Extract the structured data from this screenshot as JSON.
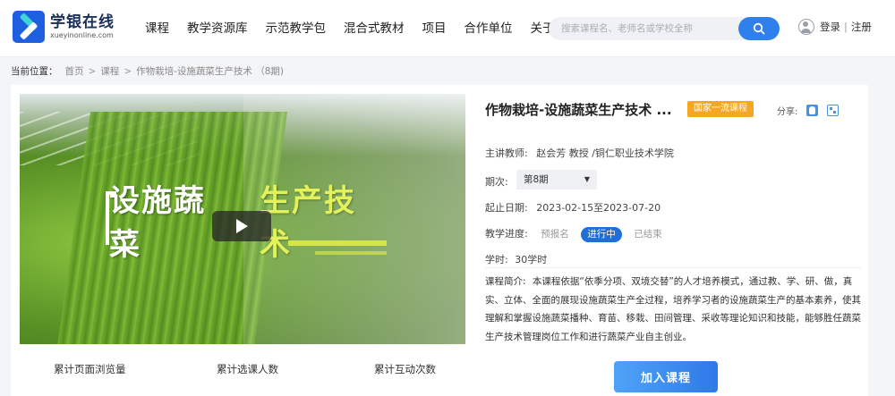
{
  "logo": {
    "name": "学银在线",
    "domain": "xueyinonline.com"
  },
  "nav": [
    "课程",
    "教学资源库",
    "示范教学包",
    "混合式教材",
    "项目",
    "合作单位",
    "关于我们"
  ],
  "search": {
    "placeholder": "搜索课程名、老师名或学校全称",
    "icon": "search-icon"
  },
  "user": {
    "login": "登录",
    "separator": "|",
    "register": "注册",
    "icon": "user-avatar-icon"
  },
  "breadcrumb": {
    "label": "当前位置：",
    "items": [
      "首页",
      "课程",
      "作物栽培-设施蔬菜生产技术 （8期)"
    ],
    "separator": ">"
  },
  "video": {
    "title_part1": "设施蔬菜",
    "title_part2": "生产技术",
    "play_icon": "play-icon"
  },
  "course": {
    "title": "作物栽培-设施蔬菜生产技术 ...",
    "badge": "国家一流课程",
    "share_label": "分享:",
    "teacher_label": "主讲教师:",
    "teacher_value": "赵会芳 教授 /铜仁职业技术学院",
    "period_label": "期次:",
    "period_value": "第8期",
    "date_label": "起止日期:",
    "date_value": "2023-02-15至2023-07-20",
    "progress_label": "教学进度:",
    "progress_states": [
      "预报名",
      "进行中",
      "已结束"
    ],
    "hours_label": "学时:",
    "hours_value": "30学时",
    "intro_label": "课程简介:",
    "intro_text": "本课程依据“依季分项、双境交替”的人才培养模式，通过教、学、研、做，真实、立体、全面的展现设施蔬菜生产全过程，培养学习者的设施蔬菜生产的基本素养，使其理解和掌握设施蔬菜播种、育苗、移栽、田间管理、采收等理论知识和技能，能够胜任蔬菜生产技术管理岗位工作和进行蔬菜产业自主创业。"
  },
  "stats": [
    "累计页面浏览量",
    "累计选课人数",
    "累计互动次数"
  ],
  "join_button": "加入课程",
  "colors": {
    "accent": "#2f80ed",
    "badge": "#f5a623",
    "status_active": "#1f6fd8"
  }
}
